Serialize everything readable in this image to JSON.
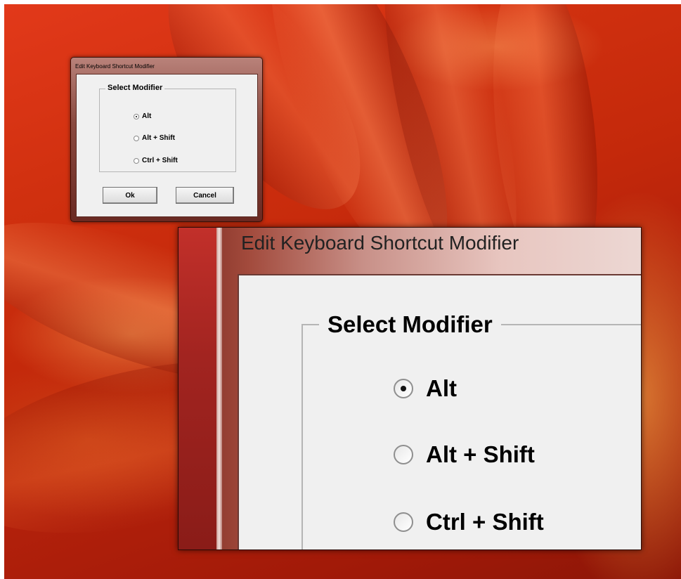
{
  "small_dialog": {
    "title": "Edit Keyboard Shortcut Modifier",
    "group_label": "Select Modifier",
    "options": [
      {
        "label": "Alt",
        "checked": true
      },
      {
        "label": "Alt + Shift",
        "checked": false
      },
      {
        "label": "Ctrl + Shift",
        "checked": false
      }
    ],
    "ok_label": "Ok",
    "cancel_label": "Cancel"
  },
  "large_dialog": {
    "title": "Edit Keyboard Shortcut Modifier",
    "group_label": "Select Modifier",
    "options": [
      {
        "label": "Alt",
        "checked": true
      },
      {
        "label": "Alt + Shift",
        "checked": false
      },
      {
        "label": "Ctrl + Shift",
        "checked": false
      }
    ]
  },
  "colors": {
    "wallpaper": "#c4290b",
    "dialog_face": "#f0f0f0",
    "frame_accent": "#a22420"
  }
}
